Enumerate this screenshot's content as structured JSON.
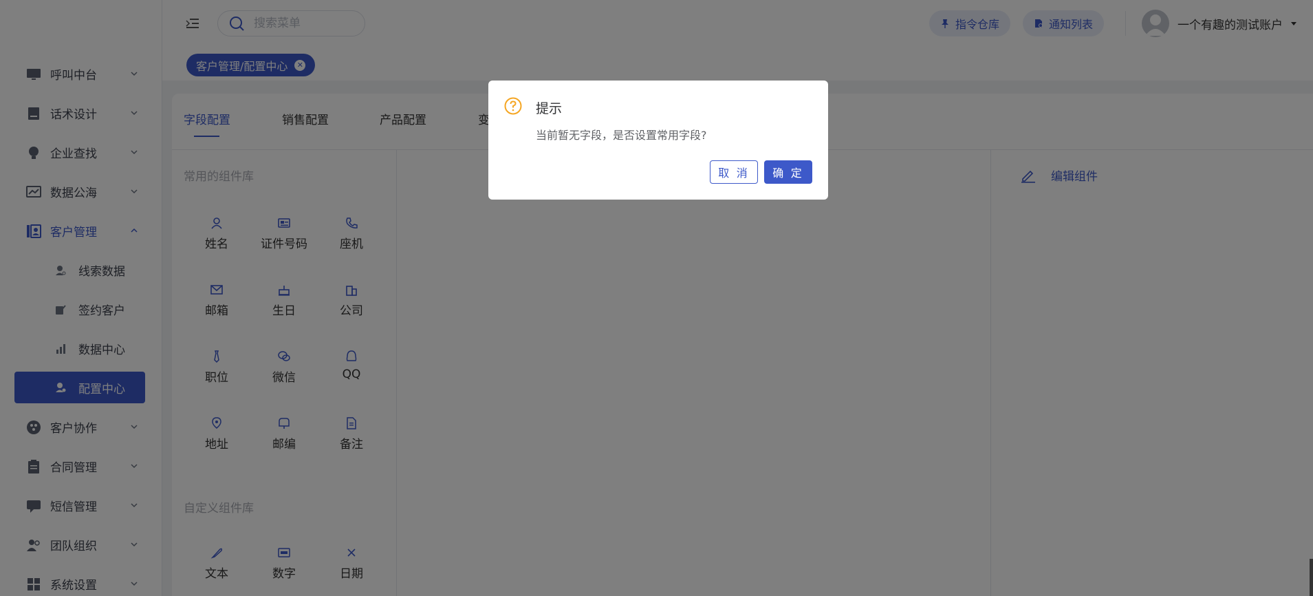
{
  "header": {
    "search_placeholder": "搜索菜单",
    "btn_instructions": "指令仓库",
    "btn_notifications": "通知列表",
    "username": "一个有趣的测试账户"
  },
  "sidebar": {
    "items": [
      {
        "label": "呼叫中台",
        "icon": "monitor-icon"
      },
      {
        "label": "话术设计",
        "icon": "book-icon"
      },
      {
        "label": "企业查找",
        "icon": "bulb-icon"
      },
      {
        "label": "数据公海",
        "icon": "chart-icon"
      },
      {
        "label": "客户管理",
        "icon": "customer-icon"
      },
      {
        "label": "客户协作",
        "icon": "collab-icon"
      },
      {
        "label": "合同管理",
        "icon": "clipboard-icon"
      },
      {
        "label": "短信管理",
        "icon": "message-icon"
      },
      {
        "label": "团队组织",
        "icon": "team-icon"
      },
      {
        "label": "系统设置",
        "icon": "grid-icon"
      }
    ],
    "sub_items": [
      {
        "label": "线索数据"
      },
      {
        "label": "签约客户"
      },
      {
        "label": "数据中心"
      },
      {
        "label": "配置中心"
      }
    ]
  },
  "tagbar": {
    "tag_label": "客户管理/配置中心"
  },
  "tabs": [
    "字段配置",
    "销售配置",
    "产品配置",
    "变"
  ],
  "left_panel": {
    "common_title": "常用的组件库",
    "common": [
      "姓名",
      "证件号码",
      "座机",
      "邮箱",
      "生日",
      "公司",
      "职位",
      "微信",
      "QQ",
      "地址",
      "邮编",
      "备注"
    ],
    "custom_title": "自定义组件库",
    "custom": [
      "文本",
      "数字",
      "日期"
    ]
  },
  "right_panel": {
    "edit_label": "编辑组件"
  },
  "dialog": {
    "title": "提示",
    "message": "当前暂无字段，是否设置常用字段?",
    "cancel": "取 消",
    "confirm": "确 定"
  },
  "colors": {
    "accent": "#3d59c9",
    "warning": "#f5a623"
  }
}
